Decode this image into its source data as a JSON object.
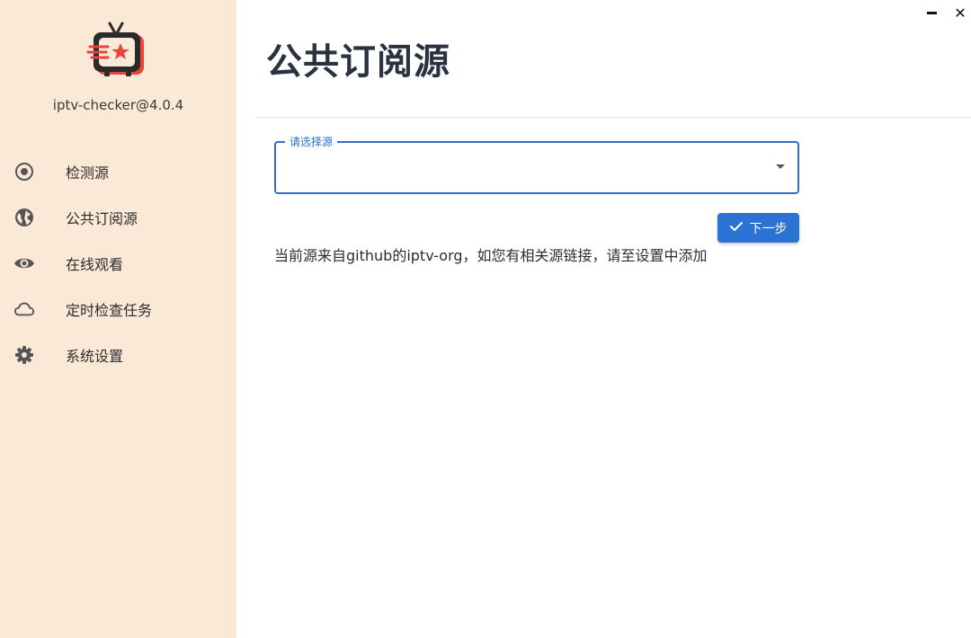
{
  "sidebar": {
    "app_version": "iptv-checker@4.0.4",
    "items": [
      {
        "label": "检测源",
        "icon": "radio-button-icon"
      },
      {
        "label": "公共订阅源",
        "icon": "globe-icon"
      },
      {
        "label": "在线观看",
        "icon": "eye-icon"
      },
      {
        "label": "定时检查任务",
        "icon": "cloud-icon"
      },
      {
        "label": "系统设置",
        "icon": "gear-icon"
      }
    ]
  },
  "window": {
    "minimize_icon": "minimize-icon",
    "close_label": "✕"
  },
  "main": {
    "title": "公共订阅源",
    "select": {
      "label": "请选择源",
      "value": ""
    },
    "next_button": "下一步",
    "hint": "当前源来自github的iptv-org，如您有相关源链接，请至设置中添加"
  },
  "colors": {
    "sidebar_bg": "#fbe9d7",
    "accent": "#2b73d2",
    "title": "#2a3240"
  }
}
